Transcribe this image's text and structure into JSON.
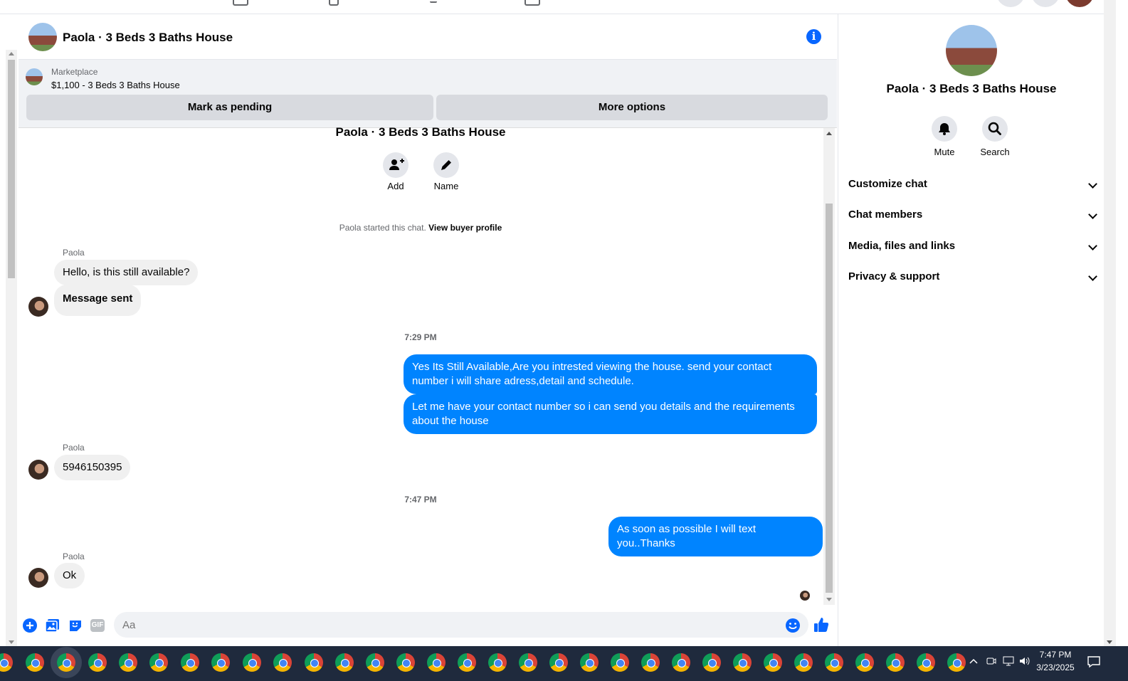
{
  "header": {
    "title": "Paola · 3 Beds 3 Baths House"
  },
  "banner": {
    "label": "Marketplace",
    "listing": "$1,100 - 3 Beds 3 Baths House",
    "mark_pending": "Mark as pending",
    "more_options": "More options"
  },
  "intro": {
    "title": "Paola · 3 Beds 3 Baths House",
    "add_label": "Add",
    "name_label": "Name",
    "started_text": "Paola started this chat.",
    "view_profile": "View buyer profile"
  },
  "messages": [
    {
      "sender": "Paola",
      "text": "Hello, is this still available?"
    },
    {
      "text": "Message sent"
    },
    {
      "time": "7:29 PM"
    },
    {
      "text": "Yes Its Still Available,Are you intrested viewing the house. send your contact number i will share adress,detail and schedule."
    },
    {
      "text": "Let me have your contact number so i can send you details and the requirements about the house"
    },
    {
      "sender": "Paola",
      "text": "5946150395"
    },
    {
      "time": "7:47 PM"
    },
    {
      "text": "As soon as possible I will text you..Thanks"
    },
    {
      "sender": "Paola",
      "text": "Ok"
    }
  ],
  "composer": {
    "placeholder": "Aa",
    "gif_label": "GIF"
  },
  "right_panel": {
    "name": "Paola · 3 Beds 3 Baths House",
    "mute_label": "Mute",
    "search_label": "Search",
    "sections": [
      "Customize chat",
      "Chat members",
      "Media, files and links",
      "Privacy & support"
    ]
  },
  "taskbar": {
    "time": "7:47 PM",
    "date": "3/23/2025"
  },
  "colors": {
    "accent": "#0084ff",
    "brand_blue": "#0866ff",
    "incoming_bubble": "#f0f0f0",
    "taskbar": "#1f2a3d"
  },
  "icons": [
    "info-icon",
    "add-person-icon",
    "pencil-icon",
    "plus-icon",
    "photo-icon",
    "sticker-icon",
    "gif-icon",
    "emoji-icon",
    "thumbs-up-icon",
    "bell-icon",
    "search-icon",
    "chevron-down-icon",
    "chrome-icon"
  ]
}
